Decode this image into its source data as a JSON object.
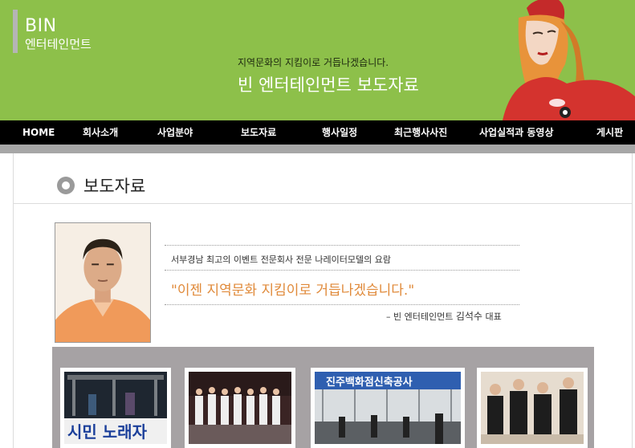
{
  "header": {
    "logo_line1": "BIN",
    "logo_line2": "엔터테인먼트",
    "tagline_small": "지역문화의 지킴이로 거듭나겠습니다.",
    "tagline_big": "빈 엔터테인먼트 보도자료"
  },
  "nav": {
    "items": [
      {
        "label": "HOME"
      },
      {
        "label": "회사소개"
      },
      {
        "label": "사업분야"
      },
      {
        "label": "보도자료"
      },
      {
        "label": "행사일정"
      },
      {
        "label": "최근행사사진"
      },
      {
        "label": "사업실적과 동영상"
      },
      {
        "label": "게시판"
      }
    ]
  },
  "main": {
    "page_title": "보도자료",
    "description": "서부경남 최고의 이벤트 전문회사 전문 나레이터모델의 요람",
    "quote": "\"이젠 지역문화 지킴이로 거듭나겠습니다.\"",
    "signature_prefix": "– 빈 엔터테인먼트",
    "signature_name": "김석수",
    "signature_title": "대표"
  },
  "gallery": {
    "thumb1_banner": "시민 노래자",
    "thumb3_sign": "진주백화점신축공사"
  },
  "colors": {
    "header_green": "#8dc04a",
    "nav_black": "#000000",
    "quote_orange": "#e08a3a",
    "gallery_gray": "#a6a2a4"
  }
}
